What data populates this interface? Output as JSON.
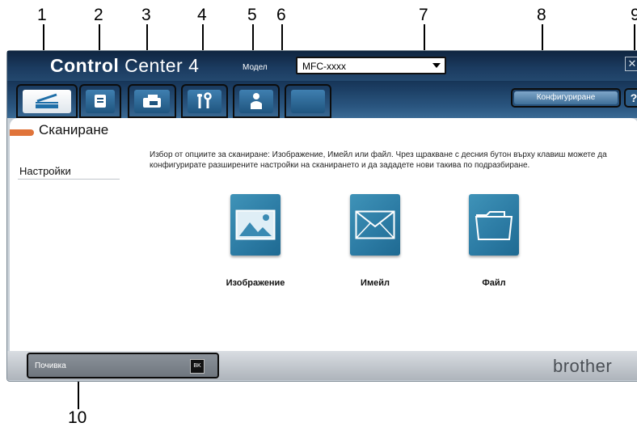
{
  "callouts": [
    "1",
    "2",
    "3",
    "4",
    "5",
    "6",
    "7",
    "8",
    "9",
    "10"
  ],
  "window": {
    "title_left": "Control",
    "title_right": "Center 4",
    "model_label": "Модел",
    "model_value": "MFC-xxxx",
    "close_icon": "close-icon"
  },
  "tabs": [
    {
      "name": "scan",
      "icon": "scanner-icon"
    },
    {
      "name": "pc-copy",
      "icon": "document-icon"
    },
    {
      "name": "pc-fax",
      "icon": "fax-icon"
    },
    {
      "name": "device-settings",
      "icon": "tools-icon"
    },
    {
      "name": "support",
      "icon": "person-icon"
    },
    {
      "name": "custom",
      "icon": ""
    }
  ],
  "toolbar": {
    "config_label": "Конфигуриране",
    "help_label": "?"
  },
  "section": {
    "title": "Сканиране",
    "sidebar_item": "Настройки",
    "description": "Избор от опциите за сканиране: Изображение, Имейл или файл. Чрез щракване с десния бутон върху клавиш можете да конфигурирате разширените настройки на сканирането и да зададете нови такива по подразбиране."
  },
  "actions": [
    {
      "label": "Изображение",
      "icon": "image-icon"
    },
    {
      "label": "Имейл",
      "icon": "email-icon"
    },
    {
      "label": "Файл",
      "icon": "folder-icon"
    }
  ],
  "footer": {
    "ink_label": "Почивка",
    "ink_color": "BK",
    "brand": "brother"
  },
  "colors": {
    "accent": "#e0743a",
    "title_bg": "#1b3b60",
    "tile_blue": "#2b7aa3"
  }
}
